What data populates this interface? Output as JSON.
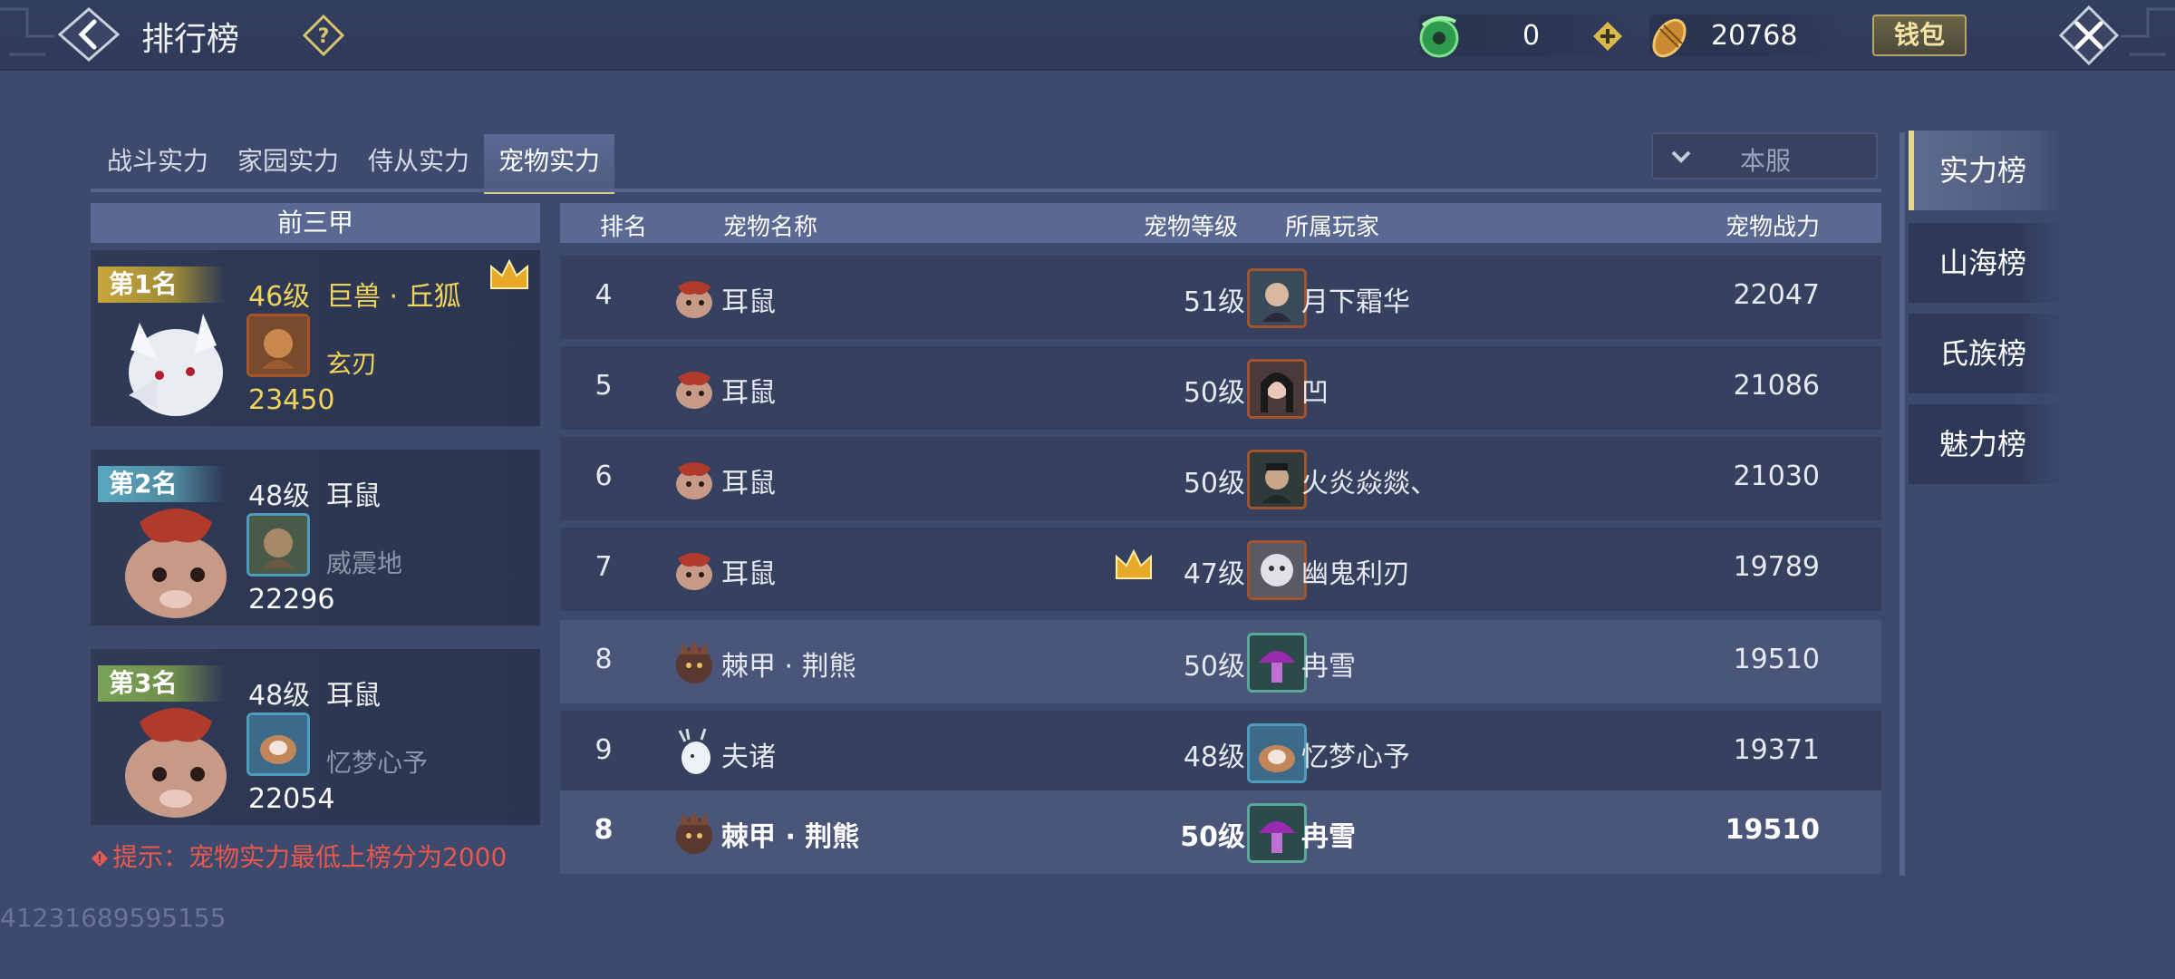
{
  "header": {
    "title": "排行榜",
    "jade_value": "0",
    "gold_value": "20768",
    "wallet_label": "钱包"
  },
  "tabs": [
    {
      "label": "战斗实力",
      "active": false
    },
    {
      "label": "家园实力",
      "active": false
    },
    {
      "label": "侍从实力",
      "active": false
    },
    {
      "label": "宠物实力",
      "active": true
    }
  ],
  "server_filter": {
    "label": "本服"
  },
  "top3": {
    "header": "前三甲",
    "cards": [
      {
        "rank_label": "第1名",
        "level": "46级",
        "pet_name": "巨兽 · 丘狐",
        "player": "玄刃",
        "score": "23450"
      },
      {
        "rank_label": "第2名",
        "level": "48级",
        "pet_name": "耳鼠",
        "player": "威震地",
        "score": "22296"
      },
      {
        "rank_label": "第3名",
        "level": "48级",
        "pet_name": "耳鼠",
        "player": "忆梦心予",
        "score": "22054"
      }
    ]
  },
  "tip": "提示：宠物实力最低上榜分为2000",
  "uid": "41231689595155",
  "table": {
    "headers": {
      "rank": "排名",
      "pet_name": "宠物名称",
      "pet_level": "宠物等级",
      "player": "所属玩家",
      "power": "宠物战力"
    },
    "rows": [
      {
        "rank": "4",
        "pet_name": "耳鼠",
        "level": "51级",
        "player": "月下霜华",
        "power": "22047"
      },
      {
        "rank": "5",
        "pet_name": "耳鼠",
        "level": "50级",
        "player": "凹",
        "power": "21086"
      },
      {
        "rank": "6",
        "pet_name": "耳鼠",
        "level": "50级",
        "player": "火炎焱燚、",
        "power": "21030"
      },
      {
        "rank": "7",
        "pet_name": "耳鼠",
        "level": "47级",
        "player": "幽鬼利刃",
        "power": "19789"
      },
      {
        "rank": "8",
        "pet_name": "棘甲 · 荆熊",
        "level": "50级",
        "player": "冉雪",
        "power": "19510"
      },
      {
        "rank": "9",
        "pet_name": "夫诸",
        "level": "48级",
        "player": "忆梦心予",
        "power": "19371"
      }
    ],
    "my_row": {
      "rank": "8",
      "pet_name": "棘甲 · 荆熊",
      "level": "50级",
      "player": "冉雪",
      "power": "19510"
    }
  },
  "rank_nav": [
    {
      "label": "实力榜",
      "active": true
    },
    {
      "label": "山海榜",
      "active": false
    },
    {
      "label": "氏族榜",
      "active": false
    },
    {
      "label": "魅力榜",
      "active": false
    }
  ]
}
